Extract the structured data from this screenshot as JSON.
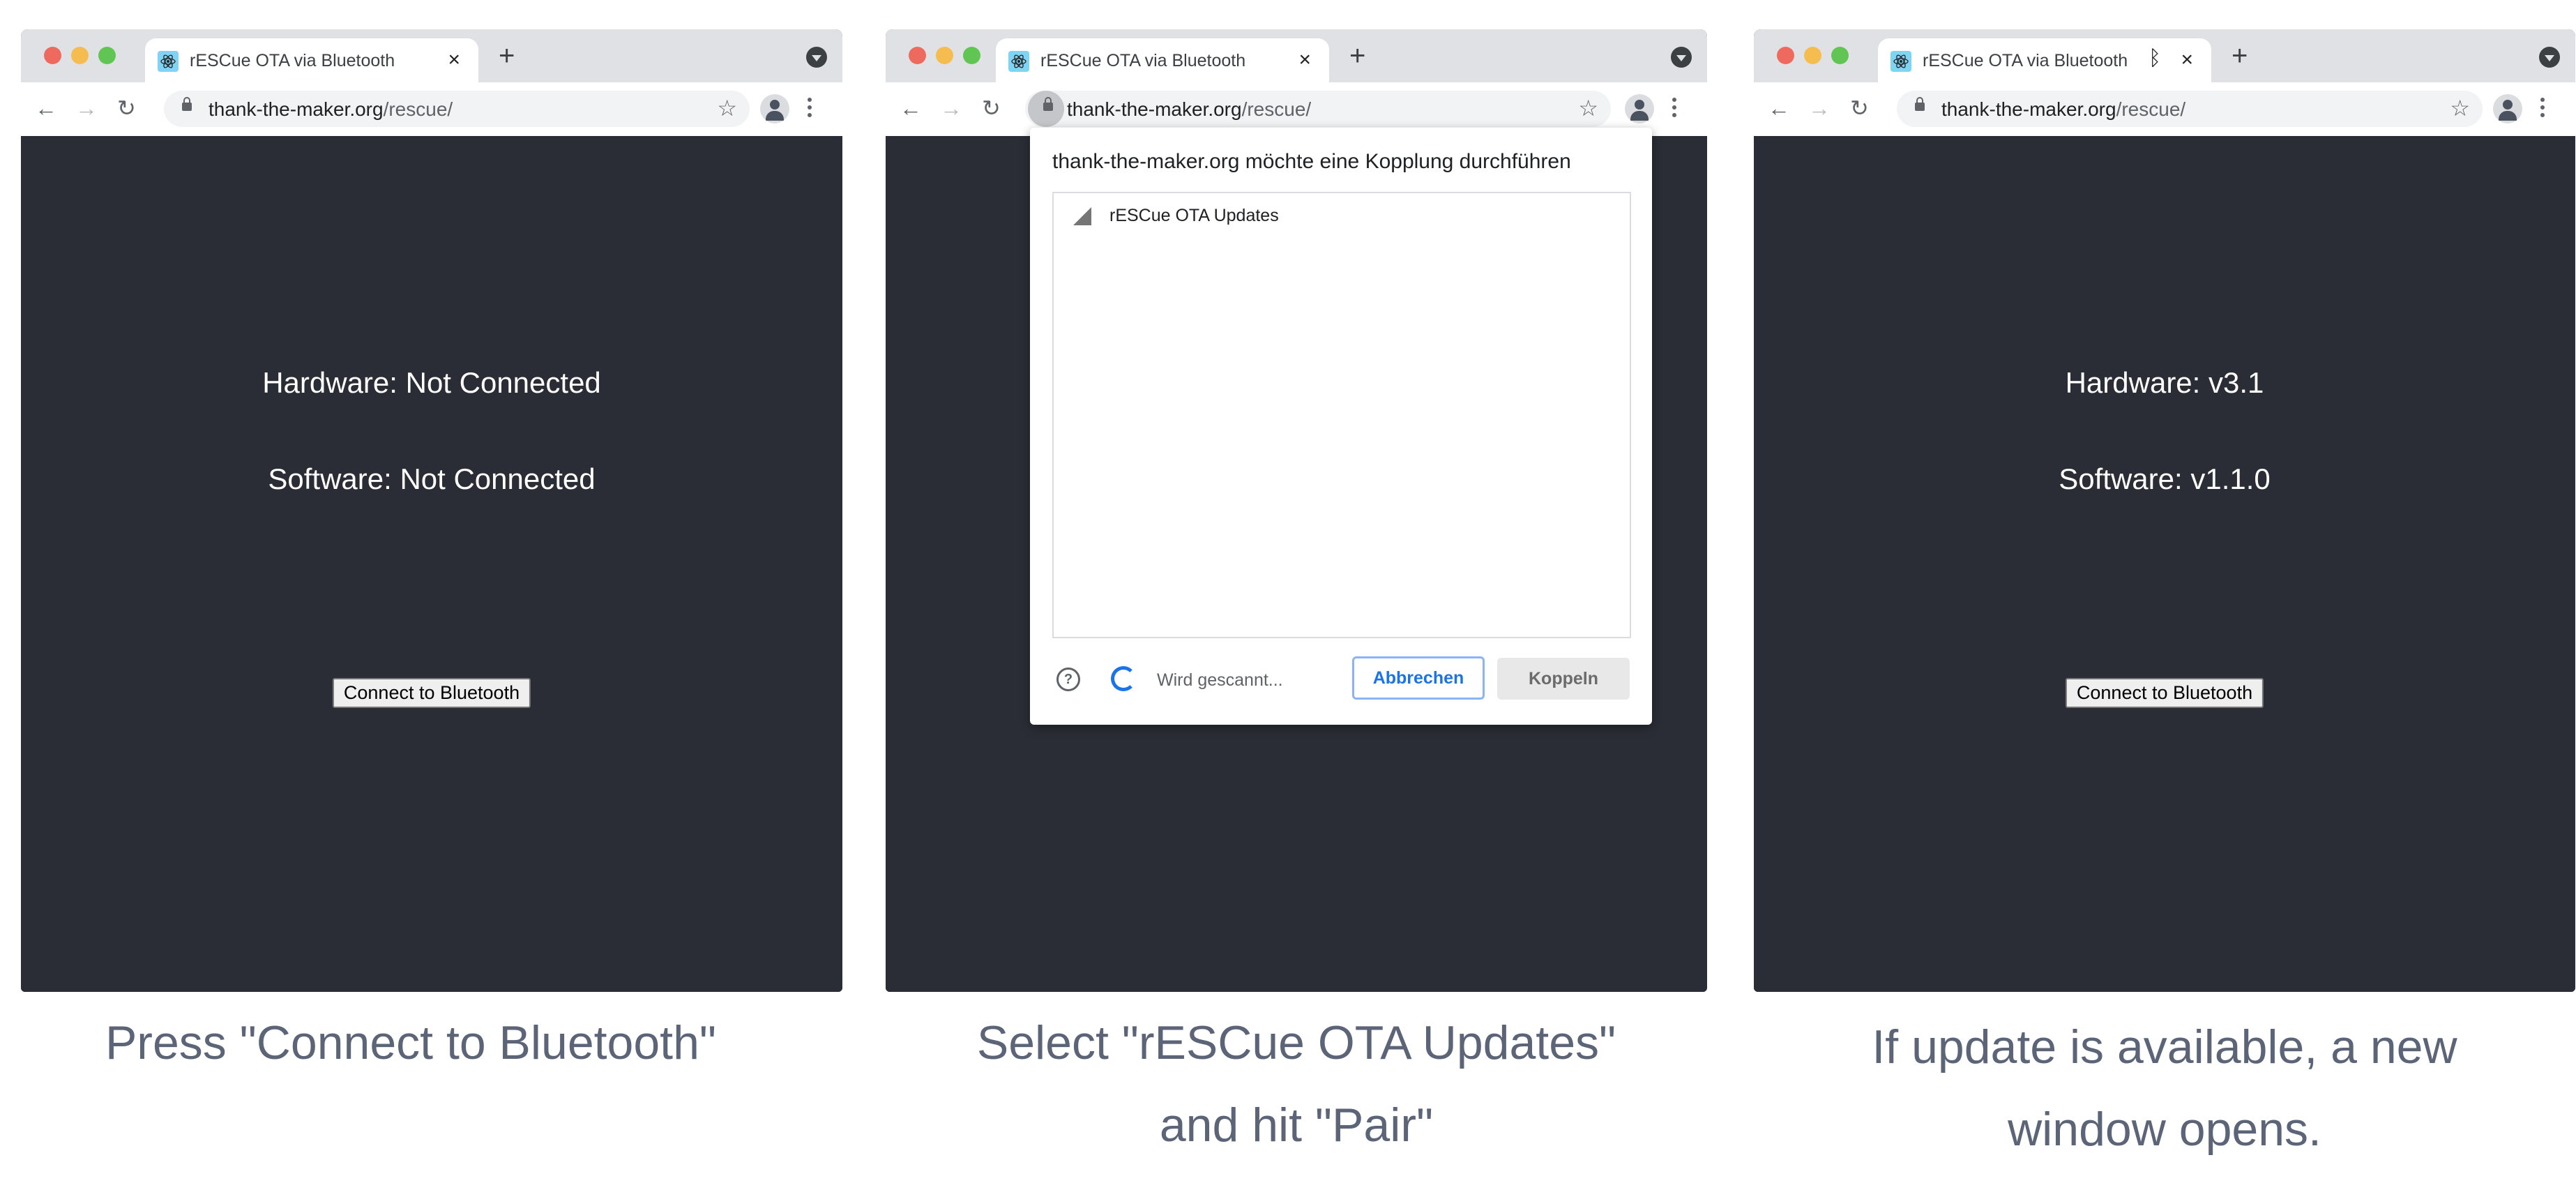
{
  "panels": [
    {
      "tab": {
        "title": "rESCue OTA via Bluetooth",
        "close_icon": "×",
        "bluetooth_indicator": false
      },
      "address": {
        "host": "thank-the-maker.org",
        "path": "/rescue/"
      },
      "content": {
        "hardware": "Hardware: Not Connected",
        "software": "Software: Not Connected",
        "button": "Connect to Bluetooth"
      },
      "caption": [
        "Press \"Connect to Bluetooth\""
      ]
    },
    {
      "tab": {
        "title": "rESCue OTA via Bluetooth",
        "close_icon": "×",
        "bluetooth_indicator": false
      },
      "address": {
        "host": "thank-the-maker.org",
        "path": "/rescue/"
      },
      "content": {
        "hardware": "Hardware: Not Connected",
        "software": "Software: Not Connected",
        "button": "Connect to Bluetooth"
      },
      "dialog": {
        "title": "thank-the-maker.org möchte eine Kopplung durchführen",
        "devices": [
          {
            "name": "rESCue OTA Updates",
            "icon": "signal-strength-icon"
          }
        ],
        "status": "Wird gescannt...",
        "cancel_label": "Abbrechen",
        "pair_label": "Koppeln",
        "help_glyph": "?"
      },
      "caption": [
        "Select \"rESCue OTA Updates\"",
        "and hit \"Pair\""
      ]
    },
    {
      "tab": {
        "title": "rESCue OTA via Bluetooth",
        "close_icon": "×",
        "bluetooth_indicator": true,
        "bluetooth_glyph": "ᛒ"
      },
      "address": {
        "host": "thank-the-maker.org",
        "path": "/rescue/"
      },
      "content": {
        "hardware": "Hardware: v3.1",
        "software": "Software: v1.1.0",
        "button": "Connect to Bluetooth"
      },
      "caption": [
        "If update is available, a new",
        "window opens."
      ]
    }
  ],
  "icons": {
    "back": "←",
    "forward": "→",
    "reload": "↻",
    "star": "☆",
    "new_tab": "+"
  },
  "colors": {
    "page_bg": "#2a2d35",
    "caption": "#5c6478",
    "accent": "#1a73e8"
  }
}
